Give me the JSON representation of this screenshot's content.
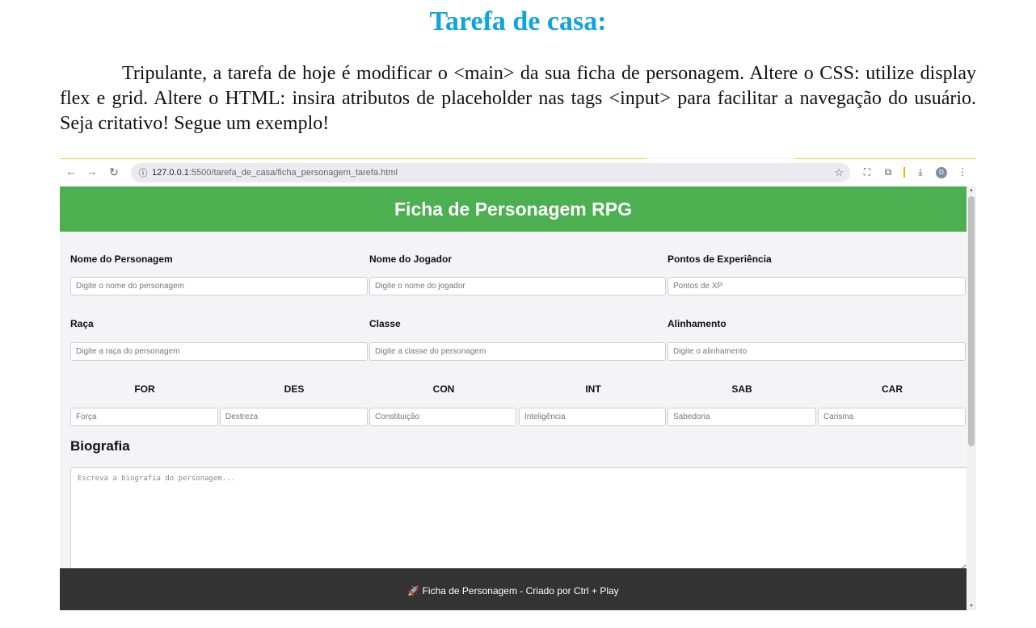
{
  "document": {
    "title": "Tarefa de casa:",
    "paragraph": "Tripulante, a tarefa de hoje é modificar o <main> da sua ficha de personagem. Altere o CSS: utilize display flex e grid. Altere o HTML: insira atributos de placeholder nas tags <input> para facilitar a navegação do usuário. Seja critativo! Segue um exemplo!"
  },
  "browser": {
    "back_icon": "arrow-left-icon",
    "forward_icon": "arrow-right-icon",
    "reload_icon": "reload-icon",
    "url_host": "127.0.0.1",
    "url_path": ":5500/tarefa_de_casa/ficha_personagem_tarefa.html",
    "profile_initial": "D"
  },
  "app": {
    "header_title": "Ficha de Personagem RPG",
    "fields": {
      "nome_personagem": {
        "label": "Nome do Personagem",
        "placeholder": "Digite o nome do personagem"
      },
      "nome_jogador": {
        "label": "Nome do Jogador",
        "placeholder": "Digite o nome do jogador"
      },
      "xp": {
        "label": "Pontos de Experiência",
        "placeholder": "Pontos de XP"
      },
      "raca": {
        "label": "Raça",
        "placeholder": "Digite a raça do personagem"
      },
      "classe": {
        "label": "Classe",
        "placeholder": "Digite a classe do personagem"
      },
      "alinhamento": {
        "label": "Alinhamento",
        "placeholder": "Digite o alinhamento"
      }
    },
    "attributes": {
      "for": {
        "label": "FOR",
        "placeholder": "Força"
      },
      "des": {
        "label": "DES",
        "placeholder": "Destreza"
      },
      "con": {
        "label": "CON",
        "placeholder": "Constituição"
      },
      "int": {
        "label": "INT",
        "placeholder": "Inteligência"
      },
      "sab": {
        "label": "SAB",
        "placeholder": "Sabedoria"
      },
      "car": {
        "label": "CAR",
        "placeholder": "Carisma"
      }
    },
    "biography": {
      "title": "Biografia",
      "placeholder": "Escreva a biografia do personagem..."
    },
    "footer_text": "🚀 Ficha de Personagem - Criado por Ctrl + Play"
  },
  "colors": {
    "title_blue": "#0fa3e0",
    "header_green": "#4caf50",
    "footer_dark": "#333333",
    "page_bg": "#f4f4f8"
  }
}
